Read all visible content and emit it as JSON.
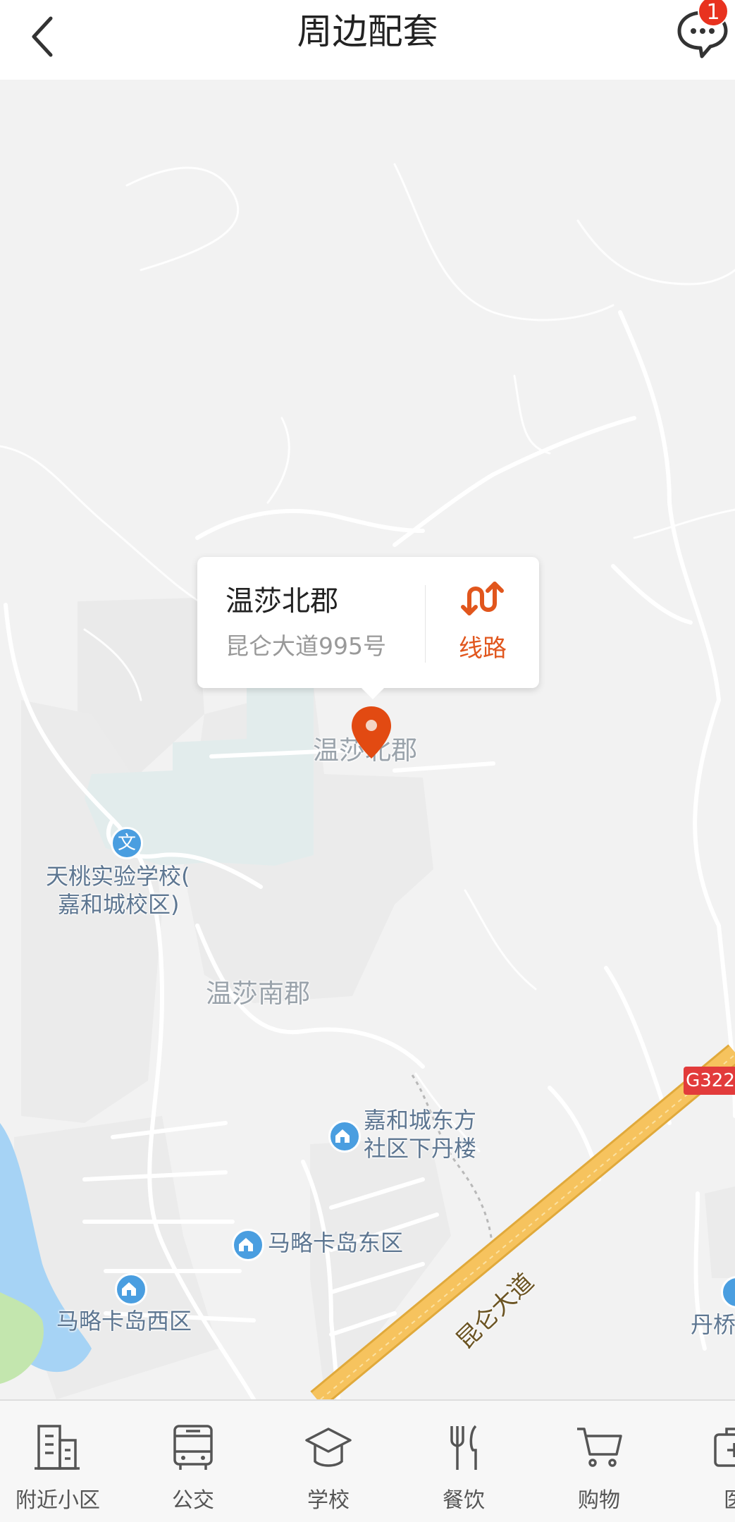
{
  "header": {
    "title": "周边配套",
    "message_badge": "1"
  },
  "popup": {
    "name": "温莎北郡",
    "address": "昆仑大道995号",
    "route_label": "线路"
  },
  "map": {
    "labels": {
      "pin_area": "温莎北郡",
      "south_area": "温莎南郡",
      "school_line1": "天桃实验学校(",
      "school_line2": "嘉和城校区)",
      "community_line1": "嘉和城东方",
      "community_line2": "社区下丹楼",
      "east_island": "马略卡岛东区",
      "west_island": "马略卡岛西区",
      "partial_right": "丹桥",
      "road_name": "昆仑大道",
      "highway": "G322"
    },
    "school_icon_glyph": "文"
  },
  "tabs": [
    {
      "label": "附近小区",
      "icon": "building-icon"
    },
    {
      "label": "公交",
      "icon": "bus-icon"
    },
    {
      "label": "学校",
      "icon": "graduation-cap-icon"
    },
    {
      "label": "餐饮",
      "icon": "fork-knife-icon"
    },
    {
      "label": "购物",
      "icon": "shopping-cart-icon"
    },
    {
      "label": "医",
      "icon": "medical-kit-icon"
    }
  ],
  "colors": {
    "accent": "#e1561d",
    "pin": "#e24a12",
    "badge": "#e8321f",
    "map_background": "#f2f2f2",
    "water": "#a6d3f5",
    "park": "#c3e6ae",
    "highway": "#f6c35e",
    "poi_label": "#5d7691"
  }
}
